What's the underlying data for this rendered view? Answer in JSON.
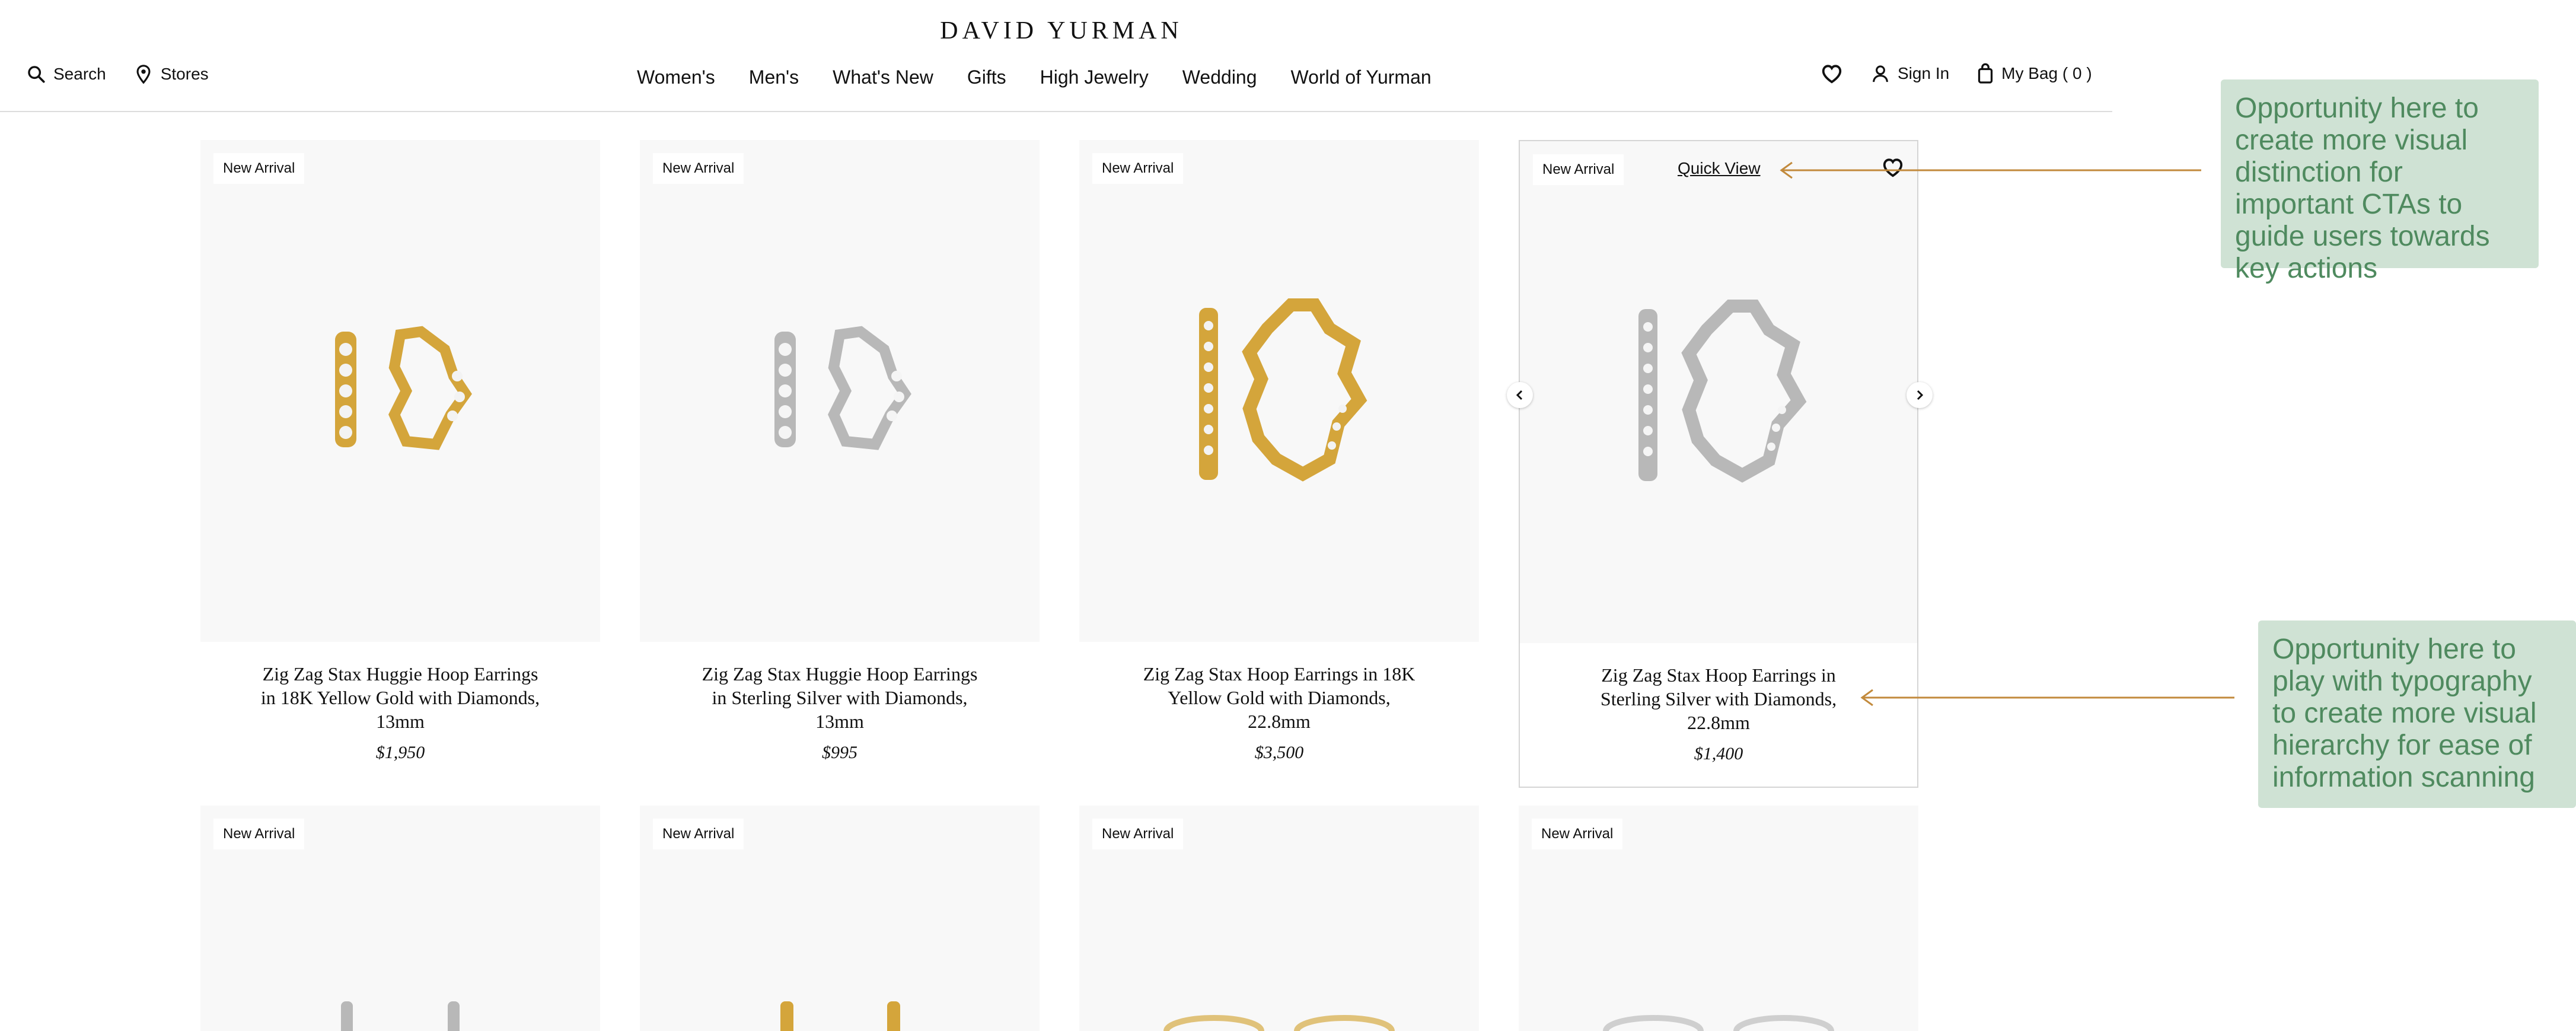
{
  "header": {
    "logo": "DAVID YURMAN",
    "search_label": "Search",
    "stores_label": "Stores",
    "sign_in_label": "Sign In",
    "bag_label": "My Bag ( 0 )",
    "nav": [
      "Women's",
      "Men's",
      "What's New",
      "Gifts",
      "High Jewelry",
      "Wedding",
      "World of Yurman"
    ]
  },
  "products": [
    {
      "badge": "New Arrival",
      "title": "Zig Zag Stax Huggie Hoop Earrings in 18K Yellow Gold with Diamonds, 13mm",
      "price": "$1,950",
      "metal": "gold",
      "style": "huggie"
    },
    {
      "badge": "New Arrival",
      "title": "Zig Zag Stax Huggie Hoop Earrings in Sterling Silver with Diamonds, 13mm",
      "price": "$995",
      "metal": "silver",
      "style": "huggie"
    },
    {
      "badge": "New Arrival",
      "title": "Zig Zag Stax Hoop Earrings in 18K Yellow Gold with Diamonds, 22.8mm",
      "price": "$3,500",
      "metal": "gold",
      "style": "hoop"
    },
    {
      "badge": "New Arrival",
      "title": "Zig Zag Stax Hoop Earrings in Sterling Silver with Diamonds, 22.8mm",
      "price": "$1,400",
      "metal": "silver",
      "style": "hoop"
    }
  ],
  "products_row2": [
    {
      "badge": "New Arrival",
      "metal": "silver"
    },
    {
      "badge": "New Arrival",
      "metal": "gold"
    },
    {
      "badge": "New Arrival",
      "metal": "gold"
    },
    {
      "badge": "New Arrival",
      "metal": "silver"
    }
  ],
  "hover_card": {
    "quick_view_label": "Quick View"
  },
  "annotations": [
    {
      "text": "Opportunity here to create more visual distinction for important CTAs to guide users towards key actions"
    },
    {
      "text": "Opportunity here to play with typography to create more visual hierarchy for ease of information scanning"
    }
  ],
  "colors": {
    "annotation_bg": "#cfe2d4",
    "annotation_text": "#4f8a5f",
    "arrow": "#c28a3c",
    "gold": "#d4a53b",
    "silver": "#b8b8b8"
  }
}
